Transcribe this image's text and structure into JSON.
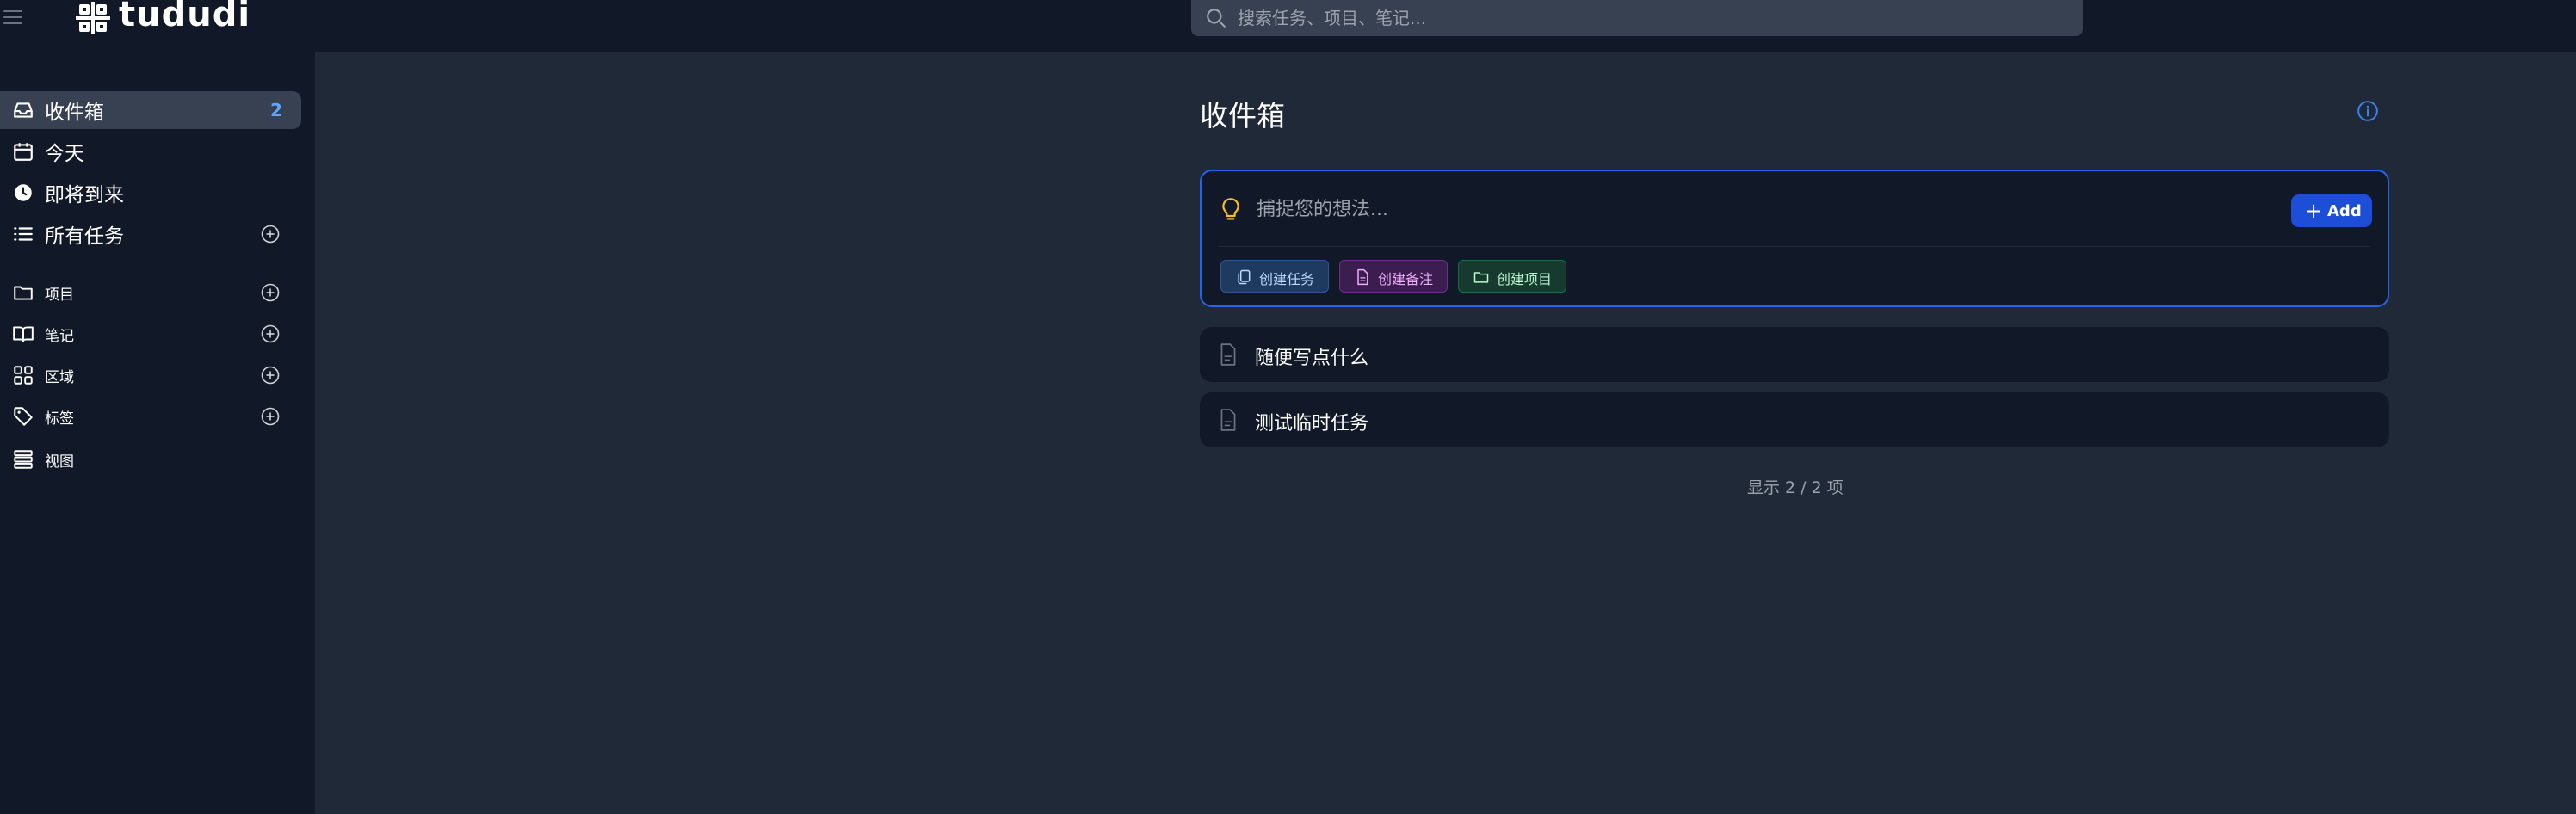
{
  "app": {
    "name": "tududi"
  },
  "search": {
    "placeholder": "搜索任务、项目、笔记..."
  },
  "sidebar": {
    "main_items": [
      {
        "label": "收件箱",
        "icon": "inbox-icon",
        "count": "2",
        "active": true
      },
      {
        "label": "今天",
        "icon": "calendar-icon"
      },
      {
        "label": "即将到来",
        "icon": "clock-icon"
      },
      {
        "label": "所有任务",
        "icon": "list-icon",
        "has_add": true
      }
    ],
    "section_items": [
      {
        "label": "项目",
        "icon": "folder-icon",
        "has_add": true
      },
      {
        "label": "笔记",
        "icon": "book-icon",
        "has_add": true
      },
      {
        "label": "区域",
        "icon": "grid-icon",
        "has_add": true
      },
      {
        "label": "标签",
        "icon": "tag-icon",
        "has_add": true
      },
      {
        "label": "视图",
        "icon": "stack-icon"
      }
    ]
  },
  "main": {
    "title": "收件箱",
    "capture": {
      "placeholder": "捕捉您的想法...",
      "add_label": "Add",
      "chips": [
        {
          "label": "创建任务",
          "icon": "copy-icon"
        },
        {
          "label": "创建备注",
          "icon": "document-icon"
        },
        {
          "label": "创建项目",
          "icon": "folder-icon"
        }
      ]
    },
    "items": [
      {
        "text": "随便写点什么",
        "icon": "document-icon"
      },
      {
        "text": "测试临时任务",
        "icon": "document-icon"
      }
    ],
    "summary": "显示 2 / 2 项"
  },
  "colors": {
    "accent": "#2563eb",
    "badge": "#60a5fa",
    "sidebar_bg": "#111827",
    "main_bg": "#1f2937"
  }
}
